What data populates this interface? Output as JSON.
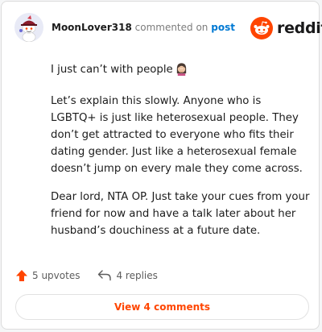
{
  "comment": {
    "username": "MoonLover318",
    "commented_on_text": "commented on",
    "post_link_label": "post",
    "paragraphs": [
      "I just can’t with people",
      "Let’s explain this slowly. Anyone who is LGBTQ+ is just like heterosexual people. They don’t get attracted to everyone who fits their dating gender. Just like a heterosexual female doesn’t jump on every male they come across.",
      "Dear lord, NTA OP. Just take your cues from your friend for now and have a talk later about her husband’s douchiness at a future date."
    ],
    "emoji_name": "woman-facepalming-icon"
  },
  "brand": {
    "wordmark": "reddit",
    "icon": "reddit-snoo-icon",
    "color": "#ff4500"
  },
  "actions": {
    "upvotes_label": "5 upvotes",
    "replies_label": "4 replies",
    "upvote_icon": "upvote-arrow-icon",
    "reply_icon": "reply-arrow-icon"
  },
  "view_comments_label": "View 4 comments",
  "colors": {
    "accent": "#ff4500",
    "link": "#0079d3",
    "text": "#1c1c1c",
    "muted": "#7c7c7c"
  }
}
